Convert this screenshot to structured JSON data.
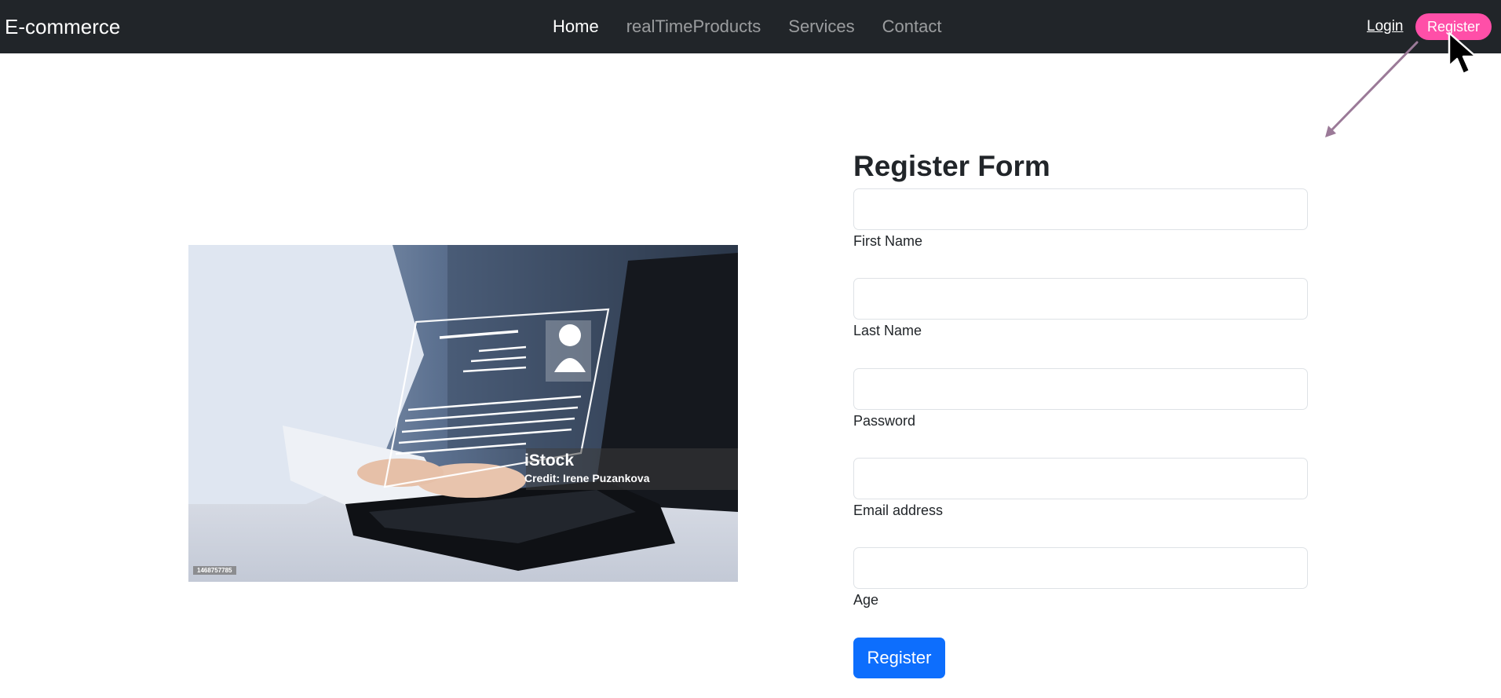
{
  "navbar": {
    "brand": "E-commerce",
    "links": [
      {
        "label": "Home",
        "active": true
      },
      {
        "label": "realTimeProducts",
        "active": false
      },
      {
        "label": "Services",
        "active": false
      },
      {
        "label": "Contact",
        "active": false
      }
    ],
    "login_label": "Login",
    "register_label": "Register"
  },
  "image": {
    "watermark_brand": "iStock",
    "watermark_credit": "Credit: Irene Puzankova",
    "image_id": "1468757785"
  },
  "form": {
    "title": "Register Form",
    "fields": [
      {
        "label": "First Name",
        "value": ""
      },
      {
        "label": "Last Name",
        "value": ""
      },
      {
        "label": "Password",
        "value": ""
      },
      {
        "label": "Email address",
        "value": ""
      },
      {
        "label": "Age",
        "value": ""
      }
    ],
    "submit_label": "Register"
  },
  "colors": {
    "navbar_bg": "#212529",
    "register_pill": "#ff4fa8",
    "primary_button": "#0d6efd",
    "annotation_arrow": "#9b7a98"
  },
  "icons": [
    "mouse-cursor-icon",
    "annotation-arrow-icon"
  ]
}
